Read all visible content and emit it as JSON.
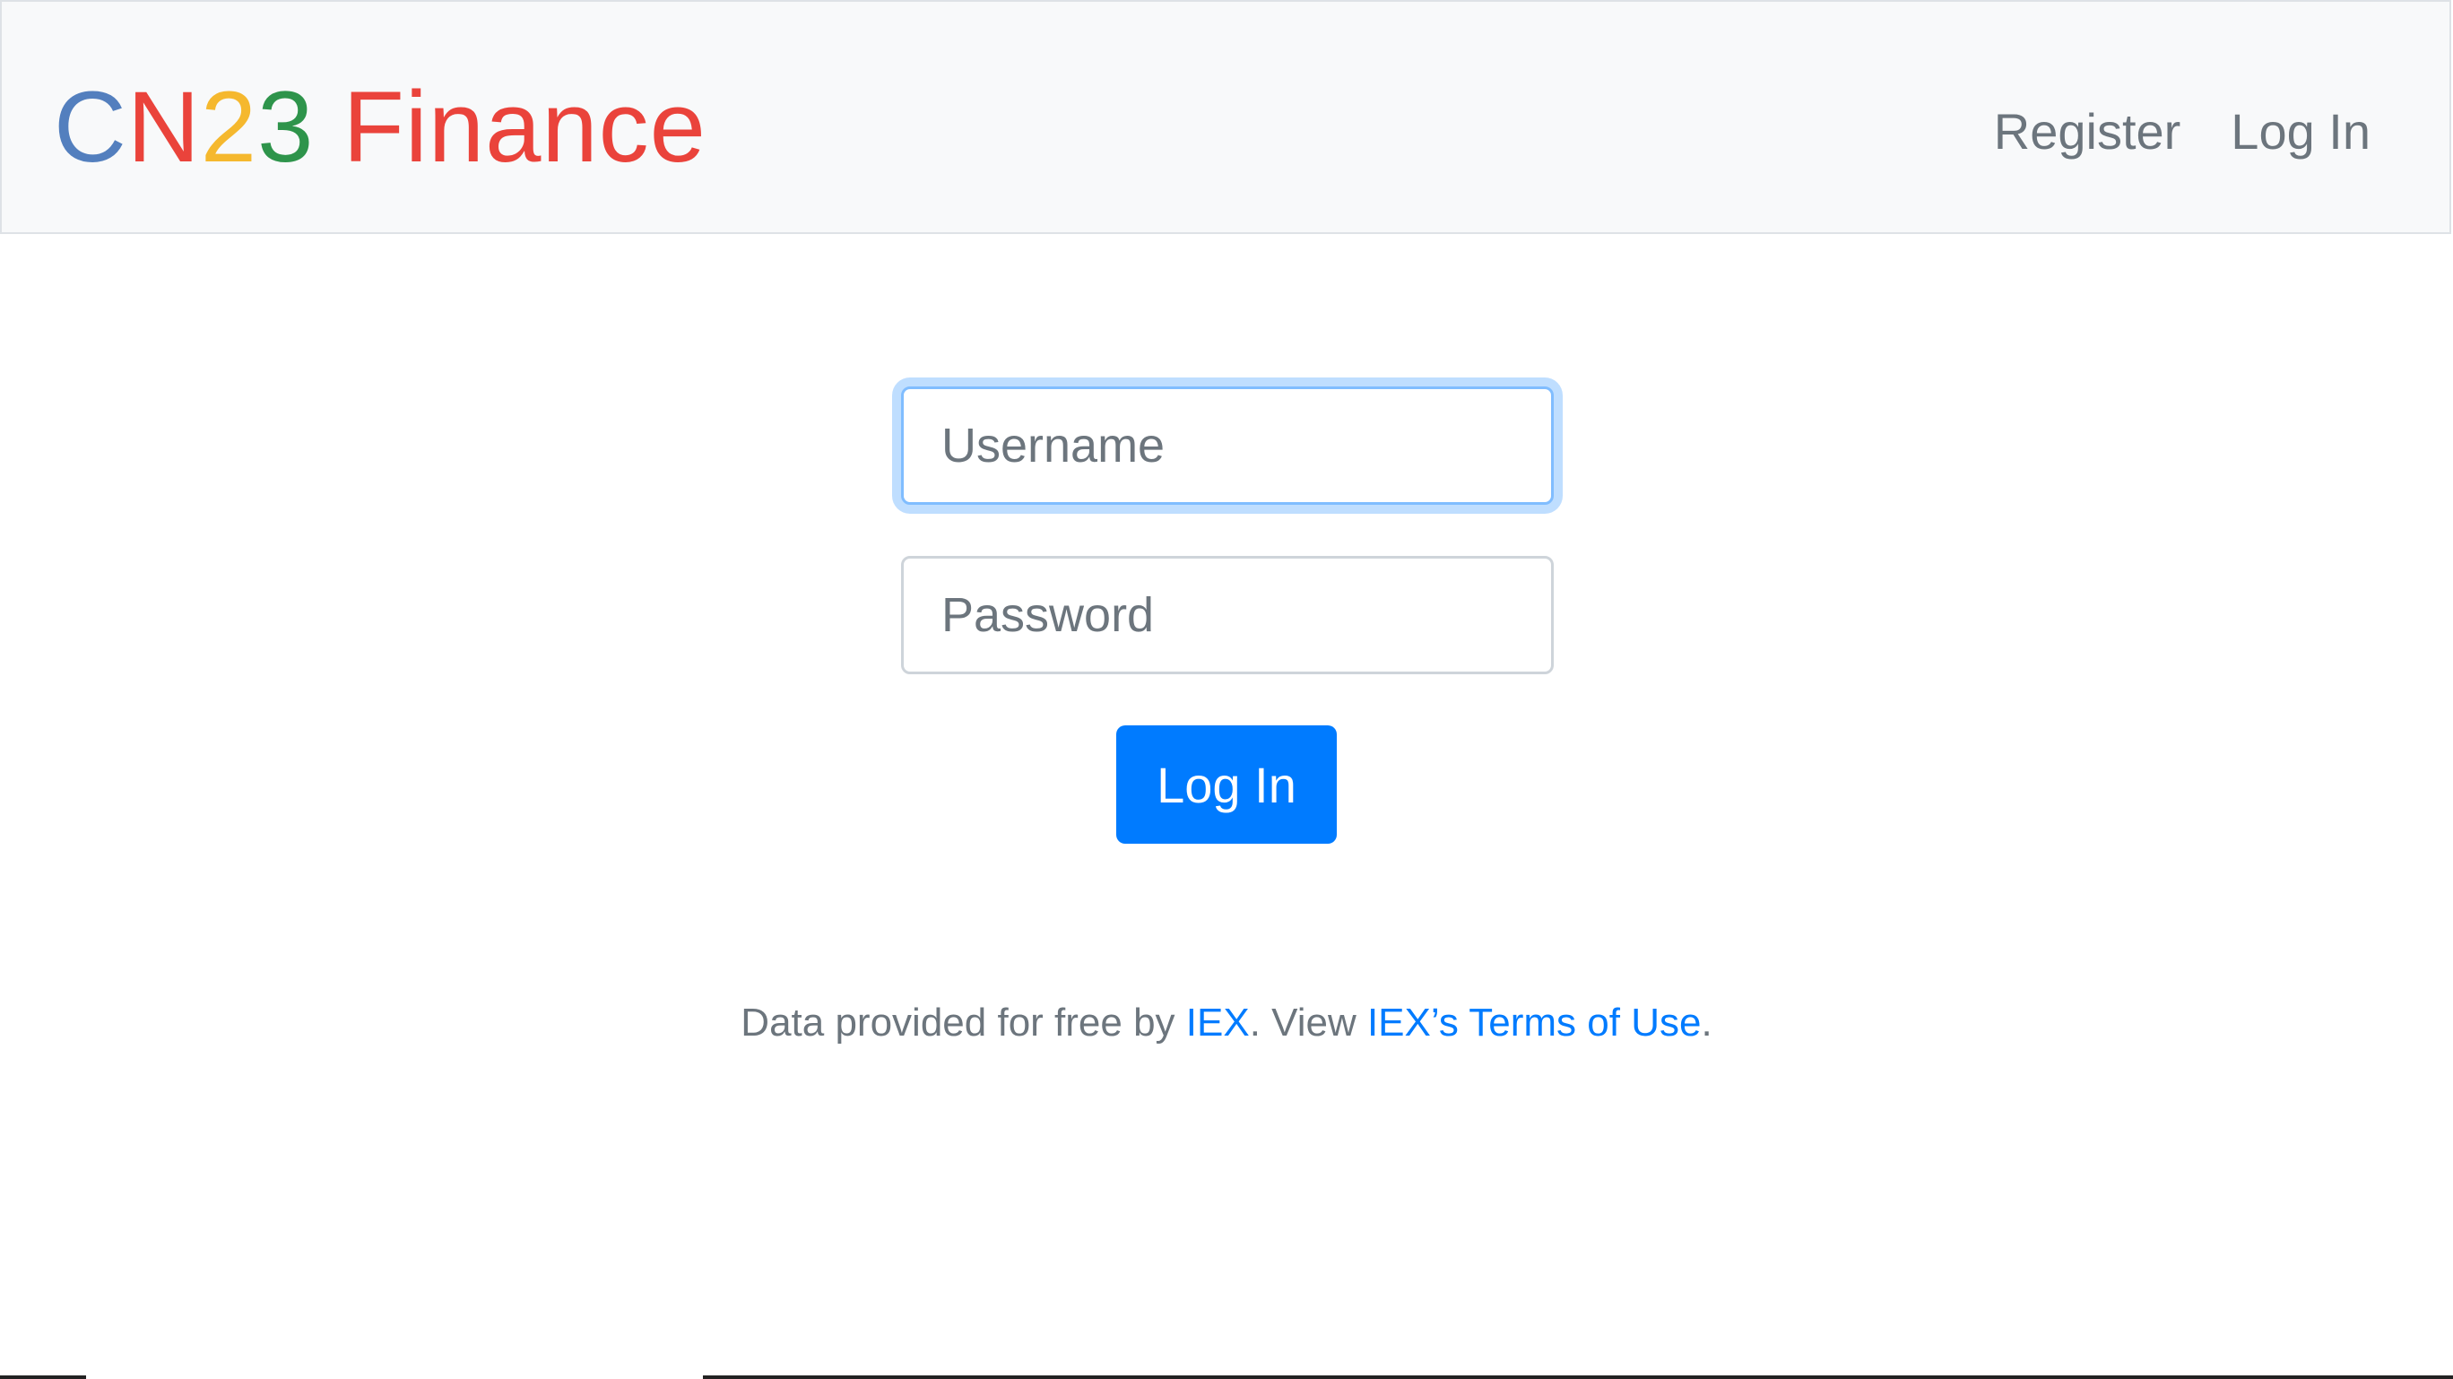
{
  "navbar": {
    "brand": {
      "letters": [
        {
          "text": "C",
          "color": "#537fbe"
        },
        {
          "text": "N",
          "color": "#ea433b"
        },
        {
          "text": "2",
          "color": "#f5b82e"
        },
        {
          "text": "3",
          "color": "#2e944b"
        },
        {
          "text": " Finance",
          "color": "#ea433b"
        }
      ]
    },
    "links": {
      "register": "Register",
      "login": "Log In"
    }
  },
  "form": {
    "username": {
      "placeholder": "Username",
      "value": ""
    },
    "password": {
      "placeholder": "Password",
      "value": ""
    },
    "submit_label": "Log In"
  },
  "footer": {
    "prefix": "Data provided for free by ",
    "iex_link": "IEX",
    "middle": ". View ",
    "terms_link": "IEX’s Terms of Use",
    "suffix": "."
  },
  "colors": {
    "primary": "#007bff",
    "muted": "#6c757d",
    "navbar_bg": "#f8f9fa"
  }
}
